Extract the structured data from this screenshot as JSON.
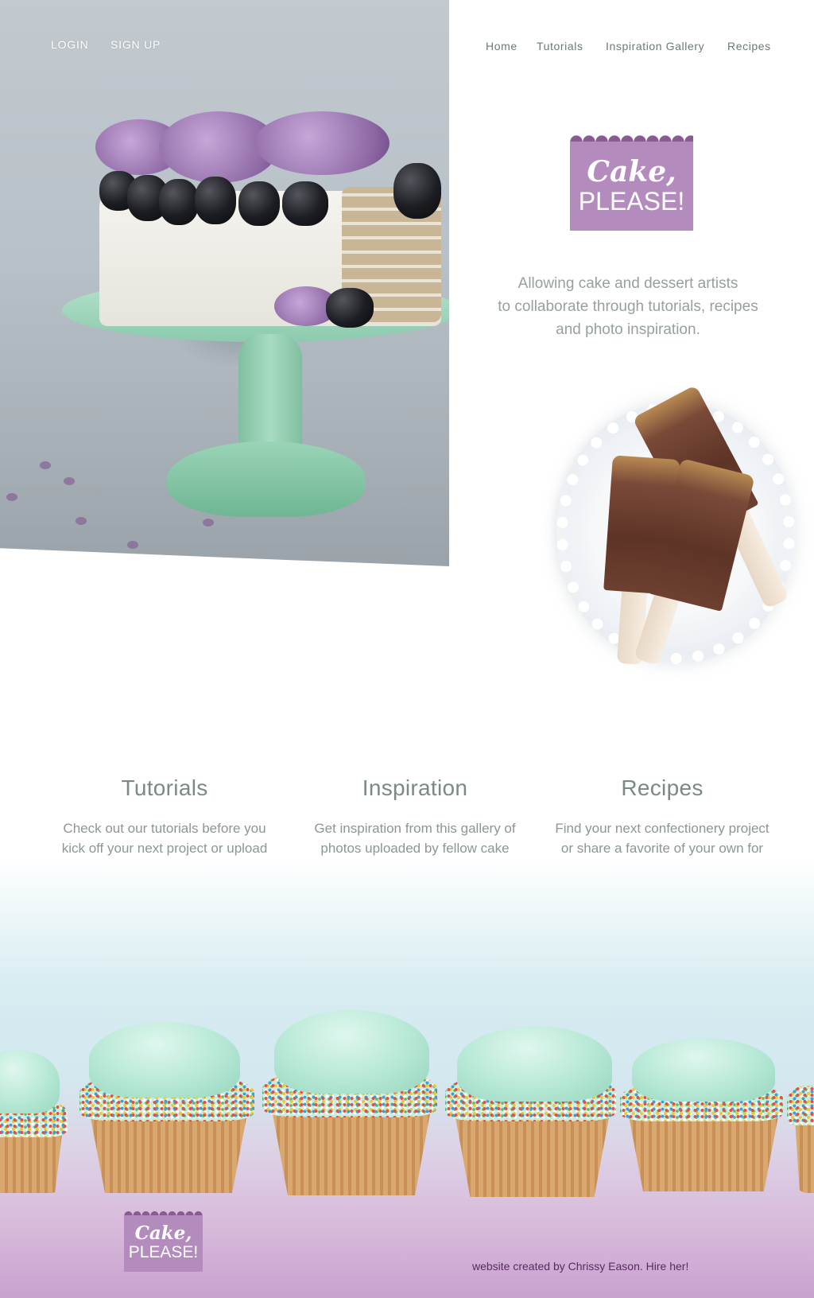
{
  "auth": {
    "login_label": "LOGIN",
    "signup_label": "SIGN UP"
  },
  "nav": {
    "items": [
      {
        "label": "Home"
      },
      {
        "label": "Tutorials"
      },
      {
        "label": "Inspiration Gallery"
      },
      {
        "label": "Recipes"
      }
    ]
  },
  "brand": {
    "script": "Cake,",
    "caps": "PLEASE!",
    "color": "#b48bbd"
  },
  "hero": {
    "tagline_lines": [
      "Allowing cake and dessert artists",
      "to collaborate through tutorials, recipes",
      "and photo inspiration."
    ]
  },
  "features": [
    {
      "title": "Tutorials",
      "text": "Check out our tutorials before you kick off your next project or upload your own video to help the cake community grow."
    },
    {
      "title": "Inspiration",
      "text": "Get inspiration from this gallery of photos uploaded by fellow cake lovers or upload your own and inspire others."
    },
    {
      "title": "Recipes",
      "text": "Find your next confectionery project or share a favorite of your own for others to enjoy."
    }
  ],
  "footer": {
    "credit": "website created by Chrissy Eason. Hire her!",
    "credit_color": "#5a2a63"
  }
}
